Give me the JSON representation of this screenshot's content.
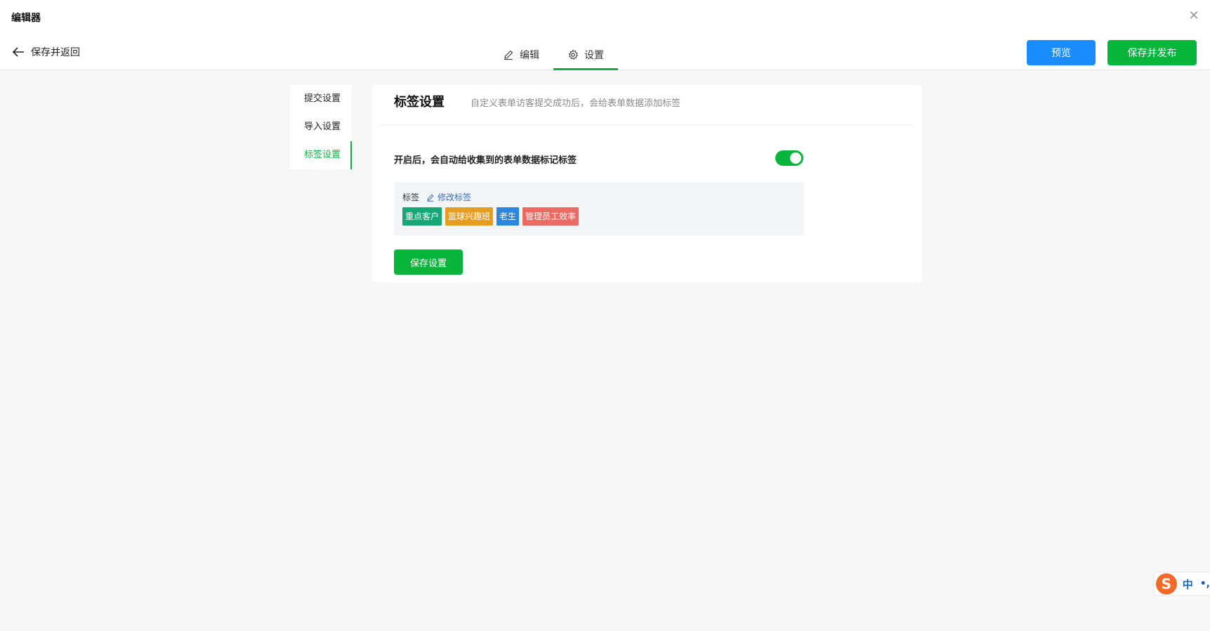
{
  "window": {
    "title": "编辑器"
  },
  "header": {
    "back_label": "保存并返回",
    "tabs": [
      {
        "label": "编辑",
        "icon": "pencil-icon"
      },
      {
        "label": "设置",
        "icon": "gear-icon"
      }
    ],
    "active_tab": "设置",
    "preview_label": "预览",
    "publish_label": "保存并发布"
  },
  "sidebar": {
    "items": [
      {
        "label": "提交设置"
      },
      {
        "label": "导入设置"
      },
      {
        "label": "标签设置"
      }
    ],
    "active": "标签设置"
  },
  "panel": {
    "title": "标签设置",
    "description": "自定义表单访客提交成功后，会给表单数据添加标签",
    "switch_label": "开启后，会自动给收集到的表单数据标记标签",
    "switch_on": true,
    "tag_label": "标签",
    "edit_label": "修改标签",
    "tags": [
      {
        "label": "重点客户",
        "color": "#16a777"
      },
      {
        "label": "篮球兴趣班",
        "color": "#e59d21"
      },
      {
        "label": "老生",
        "color": "#2b86e0"
      },
      {
        "label": "管理员工效率",
        "color": "#ec6a63"
      }
    ],
    "save_label": "保存设置"
  },
  "ime": {
    "logo": "S",
    "mode": "中",
    "punct": "•,"
  },
  "colors": {
    "accent": "#07b53b",
    "preview": "#1a8cff"
  }
}
